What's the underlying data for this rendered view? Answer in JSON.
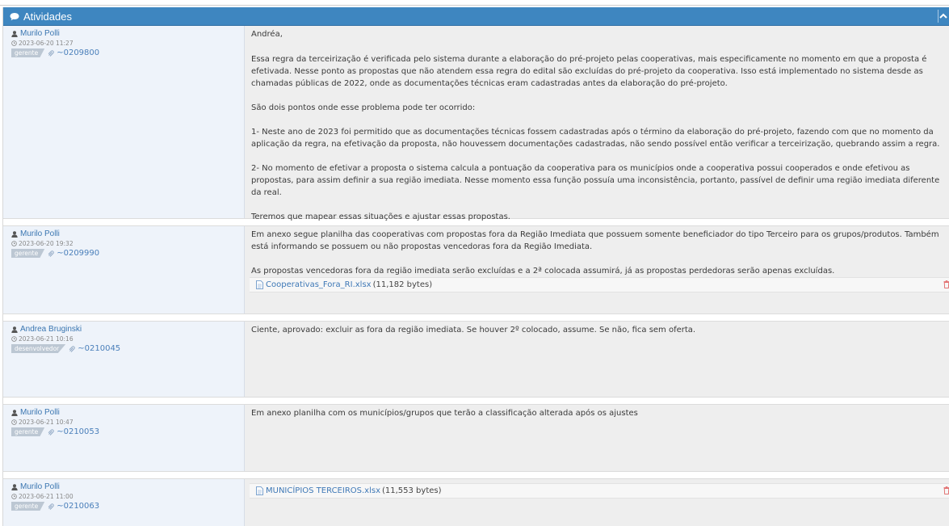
{
  "panel": {
    "title": "Atividades",
    "colors": {
      "header": "#3e86c0",
      "link": "#3a76b1",
      "role_badge": "#bcc7d3",
      "trash": "#e06666"
    },
    "icons": {
      "header": "comments-icon",
      "collapse": "chevron-up-icon",
      "author": "user-icon",
      "date": "clock-icon",
      "link": "paperclip-icon",
      "file": "file-icon",
      "delete": "trash-icon"
    }
  },
  "notes": [
    {
      "author": "Murilo Polli",
      "date": "2023-06-20 11:27",
      "role": "gerente",
      "note_id": "~0209800",
      "paragraphs": [
        "Andréa,",
        "Essa regra da terceirização é verificada pelo sistema durante a elaboração do pré-projeto pelas cooperativas, mais especificamente no momento em que a proposta é efetivada. Nesse ponto as propostas que não atendem essa regra do edital são excluídas do pré-projeto da cooperativa. Isso está implementado no sistema desde as chamadas públicas de 2022, onde as documentações técnicas eram cadastradas antes da elaboração do pré-projeto.",
        "São dois pontos onde esse problema pode ter ocorrido:",
        "1- Neste ano de 2023 foi permitido que as documentações técnicas fossem cadastradas após o término da elaboração do pré-projeto, fazendo com que no momento da aplicação da regra, na efetivação da proposta, não houvessem documentações cadastradas, não sendo possível então verificar a terceirização, quebrando assim a regra.",
        "2- No momento de efetivar a proposta o sistema calcula a pontuação da cooperativa para os municípios onde a cooperativa possui cooperados e onde efetivou as propostas, para assim definir a sua região imediata. Nesse momento essa função possuía uma inconsistência, portanto, passível de definir uma região imediata diferente da real.",
        "Teremos que mapear essas situações e ajustar essas propostas."
      ]
    },
    {
      "author": "Murilo Polli",
      "date": "2023-06-20 19:32",
      "role": "gerente",
      "note_id": "~0209990",
      "paragraphs": [
        "Em anexo segue planilha das cooperativas com propostas fora da Região Imediata que possuem somente beneficiador do tipo Terceiro para os grupos/produtos. Também está informando se possuem ou não propostas vencedoras fora da Região Imediata.",
        "As propostas vencedoras fora da região imediata serão excluídas e a 2ª colocada assumirá, já as propostas perdedoras serão apenas excluídas."
      ],
      "attachment": {
        "name": "Cooperativas_Fora_RI.xlsx",
        "size": "(11,182 bytes)"
      }
    },
    {
      "author": "Andrea Bruginski",
      "date": "2023-06-21 10:16",
      "role": "desenvolvedor",
      "note_id": "~0210045",
      "paragraphs": [
        "Ciente, aprovado: excluir as fora da região imediata. Se houver 2º colocado, assume. Se não, fica sem oferta."
      ]
    },
    {
      "author": "Murilo Polli",
      "date": "2023-06-21 10:47",
      "role": "gerente",
      "note_id": "~0210053",
      "paragraphs": [
        "Em anexo planilha com os municípios/grupos que terão a classificação alterada após os ajustes"
      ]
    },
    {
      "author": "Murilo Polli",
      "date": "2023-06-21 11:00",
      "role": "gerente",
      "note_id": "~0210063",
      "paragraphs": [],
      "attachment": {
        "name": "MUNICÍPIOS TERCEIROS.xlsx",
        "size": "(11,553 bytes)"
      }
    }
  ]
}
